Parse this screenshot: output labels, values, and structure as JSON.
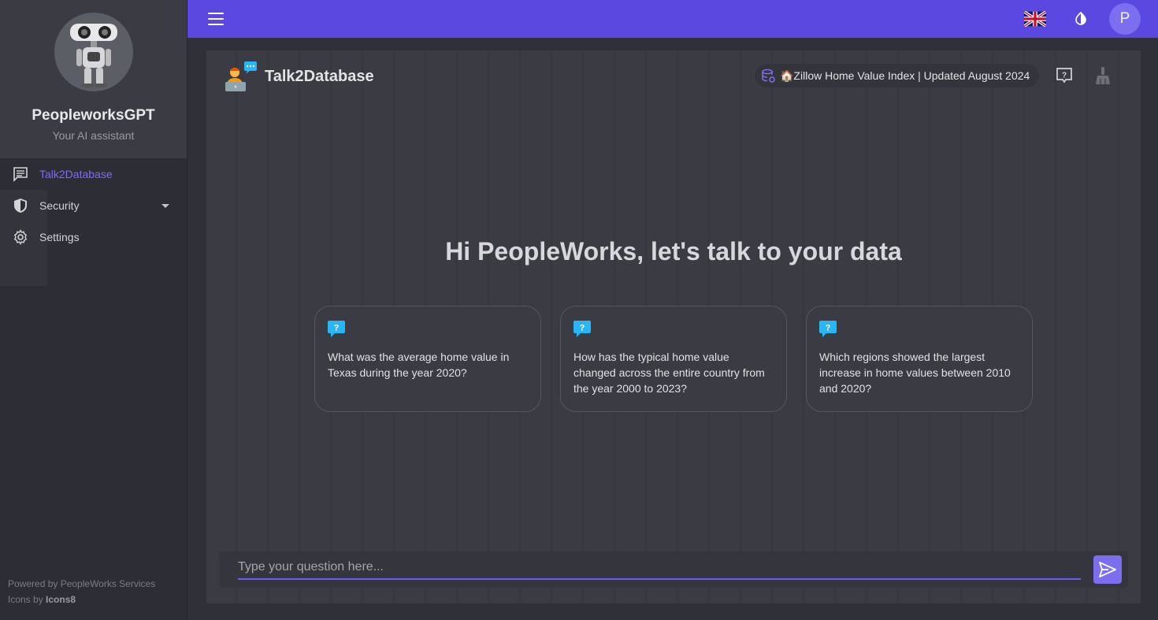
{
  "sidebar": {
    "brand": "PeopleworksGPT",
    "tagline": "Your AI assistant",
    "items": [
      {
        "label": "Talk2Database",
        "icon": "chat-icon",
        "active": true
      },
      {
        "label": "Security",
        "icon": "shield-icon",
        "expandable": true
      },
      {
        "label": "Settings",
        "icon": "gear-icon"
      }
    ],
    "footer": {
      "powered_by": "Powered by PeopleWorks Services",
      "icons_prefix": "Icons by",
      "icons_brand": "Icons8"
    }
  },
  "topbar": {
    "menu_icon": "hamburger-icon",
    "language_icon": "uk-flag-icon",
    "theme_icon": "contrast-icon",
    "user_initial": "P",
    "color": "#5a48e0"
  },
  "main": {
    "title": "Talk2Database",
    "database_chip": "🏠Zillow Home Value Index | Updated August 2024",
    "greeting": "Hi PeopleWorks, let's talk to your data",
    "suggestions": [
      {
        "text": "What was the average home value in Texas during the year 2020?"
      },
      {
        "text": "How has the typical home value changed across the entire country from the year 2000 to 2023?"
      },
      {
        "text": "Which regions showed the largest increase in home values between 2010 and 2020?"
      }
    ],
    "input_placeholder": "Type your question here...",
    "accent": "#7b6ff0"
  }
}
